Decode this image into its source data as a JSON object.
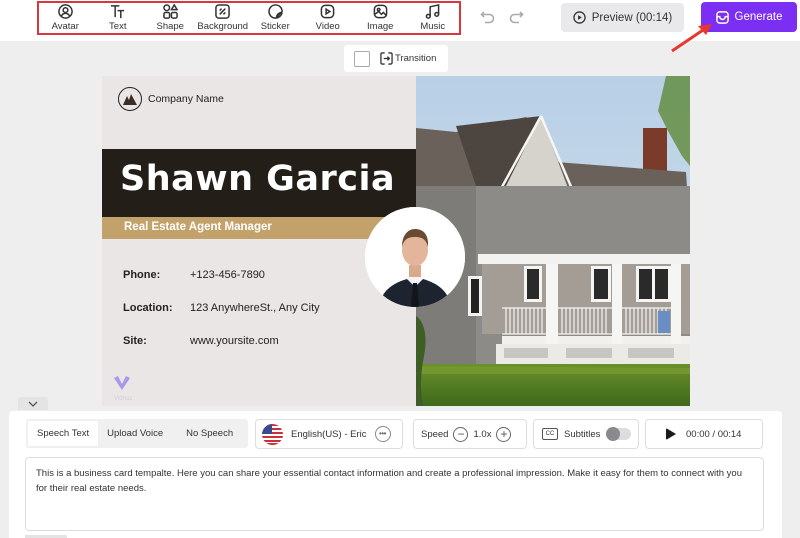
{
  "toolbar": {
    "tools": [
      {
        "label": "Avatar",
        "icon": "avatar-icon"
      },
      {
        "label": "Text",
        "icon": "text-icon"
      },
      {
        "label": "Shape",
        "icon": "shape-icon"
      },
      {
        "label": "Background",
        "icon": "background-icon"
      },
      {
        "label": "Sticker",
        "icon": "sticker-icon"
      },
      {
        "label": "Video",
        "icon": "video-icon"
      },
      {
        "label": "Image",
        "icon": "image-icon"
      },
      {
        "label": "Music",
        "icon": "music-icon"
      }
    ],
    "preview_label": "Preview (00:14)",
    "generate_label": "Generate",
    "highlight_color": "#d9363e",
    "accent_color": "#7b2ff2"
  },
  "transition": {
    "label": "Transition"
  },
  "card": {
    "company": "Company Name",
    "name": "Shawn Garcia",
    "title": "Real Estate Agent Manager",
    "contacts": [
      {
        "key": "Phone:",
        "value": "+123-456-7890"
      },
      {
        "key": "Location:",
        "value": "123 AnywhereSt., Any City"
      },
      {
        "key": "Site:",
        "value": "www.yoursite.com"
      }
    ],
    "watermark": "Vidnoz",
    "name_bar_color": "#241e18",
    "title_bar_color": "#c2a26a"
  },
  "speech": {
    "modes": [
      "Speech Text",
      "Upload Voice",
      "No Speech"
    ],
    "active_mode": "Speech Text",
    "voice": "English(US) - Eric",
    "speed_label": "Speed",
    "speed_value": "1.0x",
    "subtitles_label": "Subtitles",
    "subtitles_on": false,
    "cc_label": "CC",
    "time": "00:00 / 00:14",
    "text": "This is a business card tempalte. Here you can share your essential contact information and create a professional impression. Make it easy for them to connect with you for their real estate needs."
  }
}
